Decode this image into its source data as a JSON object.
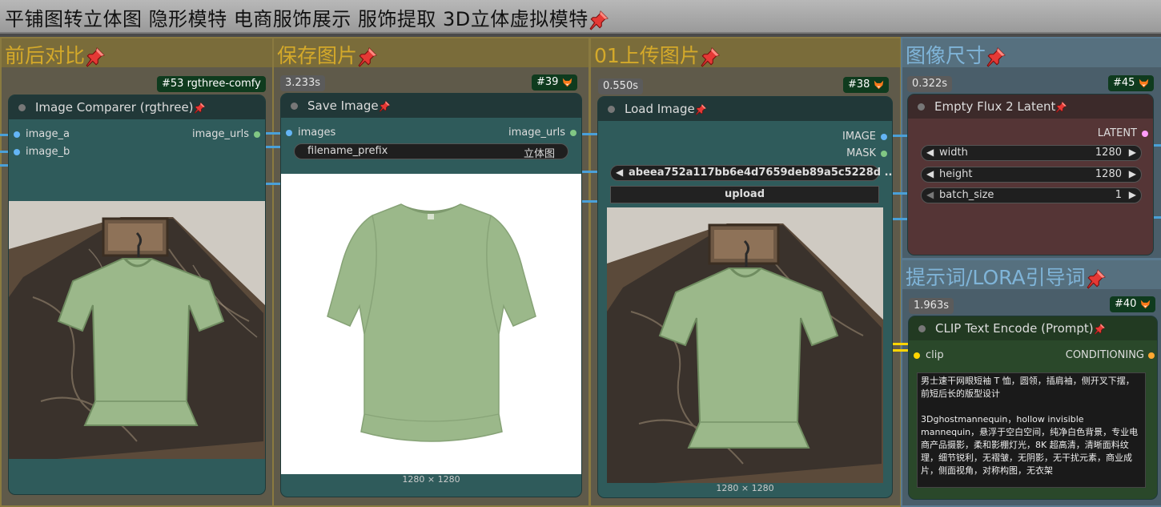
{
  "window": {
    "title": "平铺图转立体图 隐形模特 电商服饰展示 服饰提取 3D立体虚拟模特"
  },
  "groups": {
    "compare": "前后对比",
    "save": "保存图片",
    "upload": "01上传图片",
    "size": "图像尺寸",
    "prompt": "提示词/LORA引导词"
  },
  "nodes": {
    "comparer": {
      "badge": "#53 rgthree-comfy",
      "title": "Image Comparer (rgthree)",
      "inputs": [
        "image_a",
        "image_b"
      ],
      "output": "image_urls"
    },
    "save": {
      "timer": "3.233s",
      "badge": "#39",
      "title": "Save Image",
      "input": "images",
      "output": "image_urls",
      "widget_label": "filename_prefix",
      "widget_value": "立体图",
      "dims": "1280 × 1280"
    },
    "load": {
      "timer": "0.550s",
      "badge": "#38",
      "title": "Load Image",
      "outputs": [
        "IMAGE",
        "MASK"
      ],
      "file": "abeea752a117bb6e4d7659deb89a5c5228d ...",
      "upload_label": "upload",
      "dims": "1280 × 1280"
    },
    "latent": {
      "timer": "0.322s",
      "badge": "#45",
      "title": "Empty Flux 2 Latent",
      "output": "LATENT",
      "width_label": "width",
      "width": "1280",
      "height_label": "height",
      "height": "1280",
      "batch_label": "batch_size",
      "batch": "1"
    },
    "clip": {
      "timer": "1.963s",
      "badge": "#40",
      "title": "CLIP Text Encode (Prompt)",
      "input": "clip",
      "output": "CONDITIONING",
      "text_p1": "男士速干网眼短袖 T 恤，圆领，插肩袖，侧开叉下摆，前短后长的版型设计",
      "text_p2": "3Dghostmannequin，hollow invisible mannequin，悬浮于空白空间，纯净白色背景，专业电商产品摄影，柔和影棚灯光，8K 超高清，清晰面料纹理，细节锐利，无褶皱，无阴影，无干扰元素，商业成片，侧面视角，对称构图，无衣架"
    }
  },
  "colors": {
    "group_title": "#d4a92a",
    "group_title_blue": "#7fb4d8",
    "image_port": "#64b5f6",
    "mask_port": "#81c784",
    "latent_port": "#ff9cf9",
    "clip_port": "#ffd500",
    "cond_port": "#ffa931",
    "shirt": "#9bb88a"
  }
}
